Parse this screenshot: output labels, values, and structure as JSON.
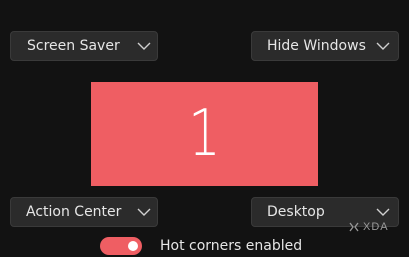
{
  "corners": {
    "top_left": {
      "value": "Screen Saver"
    },
    "top_right": {
      "value": "Hide Windows"
    },
    "bottom_left": {
      "value": "Action Center"
    },
    "bottom_right": {
      "value": "Desktop"
    }
  },
  "display": {
    "number": "1",
    "color": "#ef5e63"
  },
  "hot_corners_toggle": {
    "label": "Hot corners enabled",
    "enabled": true
  },
  "watermark": {
    "text": "XDA"
  },
  "icons": {
    "dropdown": "chevron-down-icon",
    "watermark": "xda-logo-icon"
  }
}
